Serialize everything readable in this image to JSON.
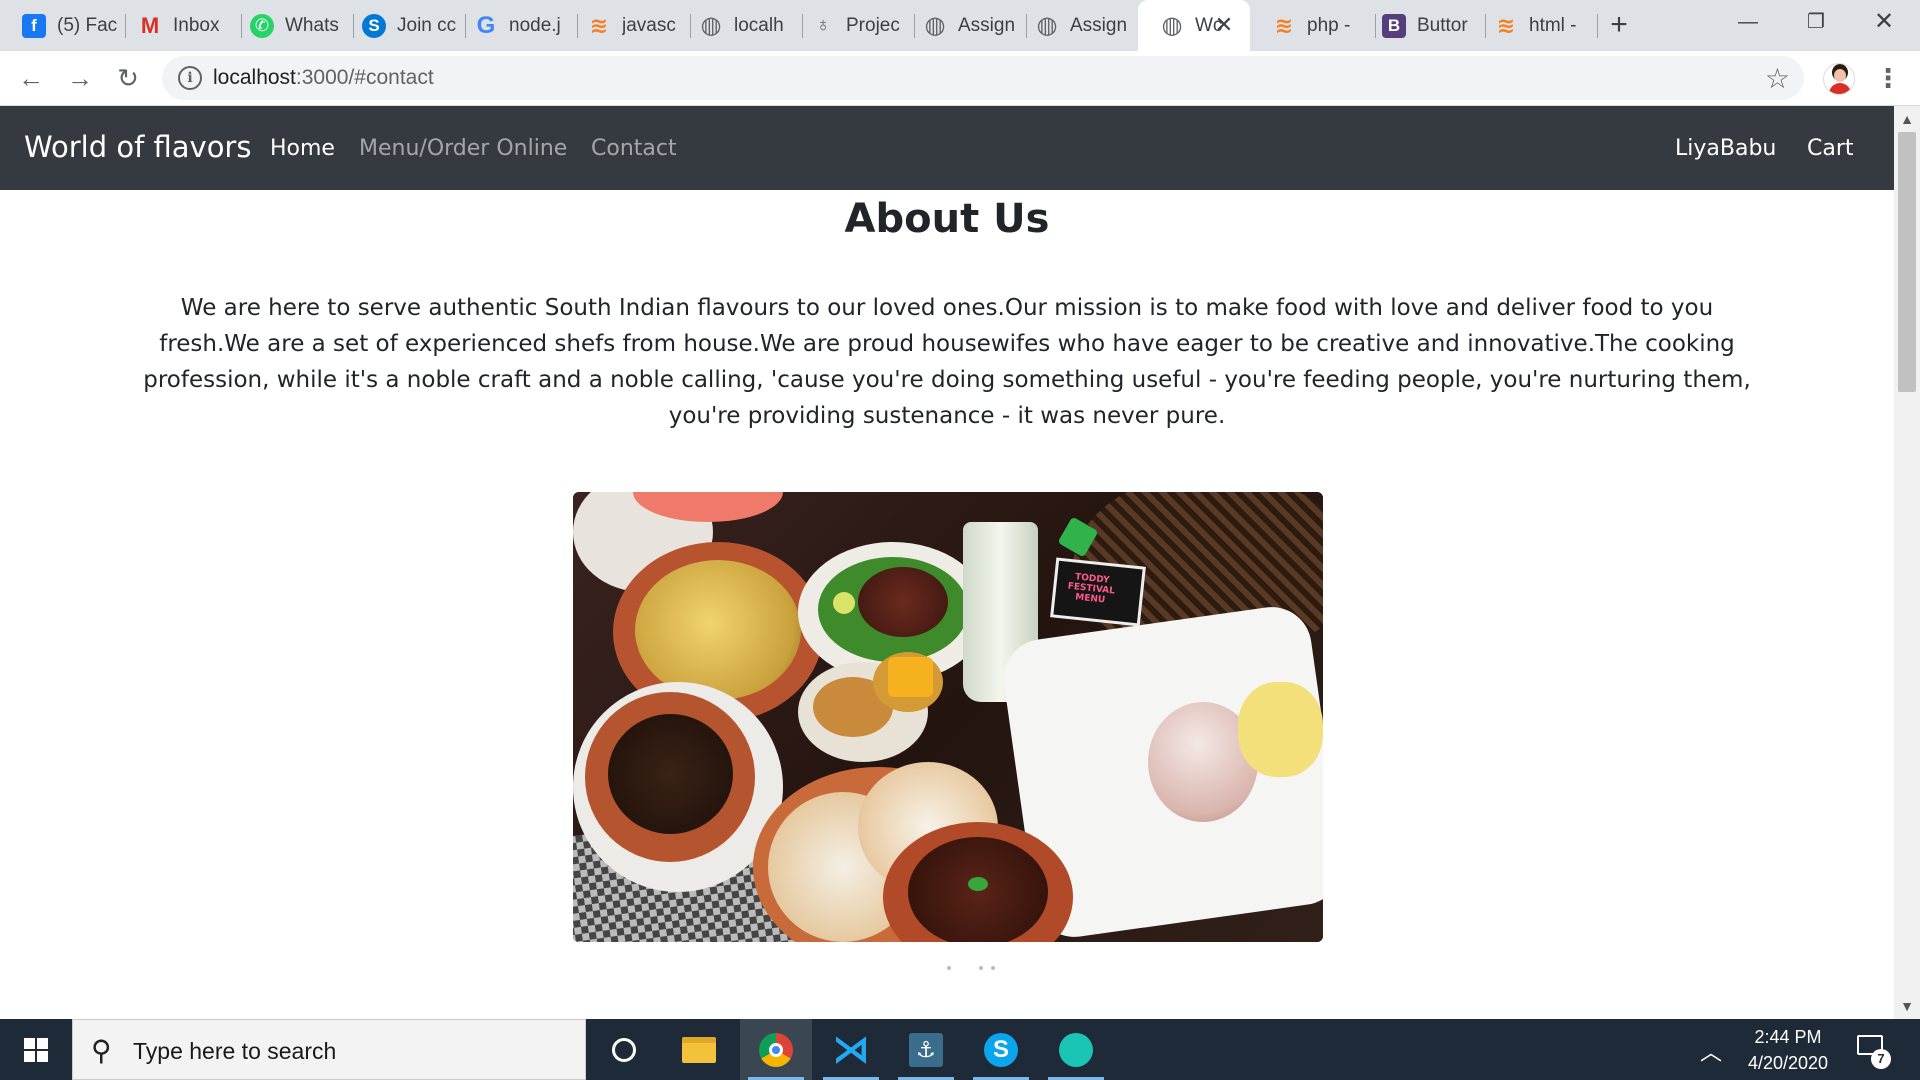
{
  "browser": {
    "tabs": [
      {
        "title": "(5) Fac",
        "icon": "facebook-icon"
      },
      {
        "title": "Inbox",
        "icon": "gmail-icon"
      },
      {
        "title": "Whats",
        "icon": "whatsapp-icon"
      },
      {
        "title": "Join cc",
        "icon": "skype-icon"
      },
      {
        "title": "node.j",
        "icon": "google-icon"
      },
      {
        "title": "javasc",
        "icon": "stackoverflow-icon"
      },
      {
        "title": "localh",
        "icon": "globe-icon"
      },
      {
        "title": "Projec",
        "icon": "microphone-icon"
      },
      {
        "title": "Assign",
        "icon": "globe-icon"
      },
      {
        "title": "Assign",
        "icon": "globe-icon"
      },
      {
        "title": "Wc",
        "icon": "globe-icon",
        "active": true
      },
      {
        "title": "php -",
        "icon": "stackoverflow-icon"
      },
      {
        "title": "Buttor",
        "icon": "bootstrap-icon"
      },
      {
        "title": "html -",
        "icon": "stackoverflow-icon"
      }
    ],
    "url_host": "localhost",
    "url_rest": ":3000/#contact"
  },
  "site": {
    "brand": "World of flavors",
    "nav": {
      "home": "Home",
      "menu": "Menu/Order Online",
      "contact": "Contact",
      "user": "LiyaBabu",
      "cart": "Cart"
    }
  },
  "about": {
    "title": "About Us",
    "text": "We are here to serve authentic South Indian flavours to our loved ones.Our mission is to make food with love and deliver food to you fresh.We are a set of experienced shefs from house.We are proud housewifes who have eager to be creative and innovative.The cooking profession, while it's a noble craft and a noble calling, 'cause you're doing something useful - you're feeding people, you're nurturing them, you're providing sustenance - it was never pure.",
    "photo_sign": "TODDY FESTIVAL MENU"
  },
  "taskbar": {
    "search_placeholder": "Type here to search",
    "time": "2:44 PM",
    "date": "4/20/2020",
    "notifications": "7"
  },
  "colors": {
    "navbar": "#343a40",
    "taskbar": "#1f2a38",
    "tabstrip": "#dee1e6"
  }
}
